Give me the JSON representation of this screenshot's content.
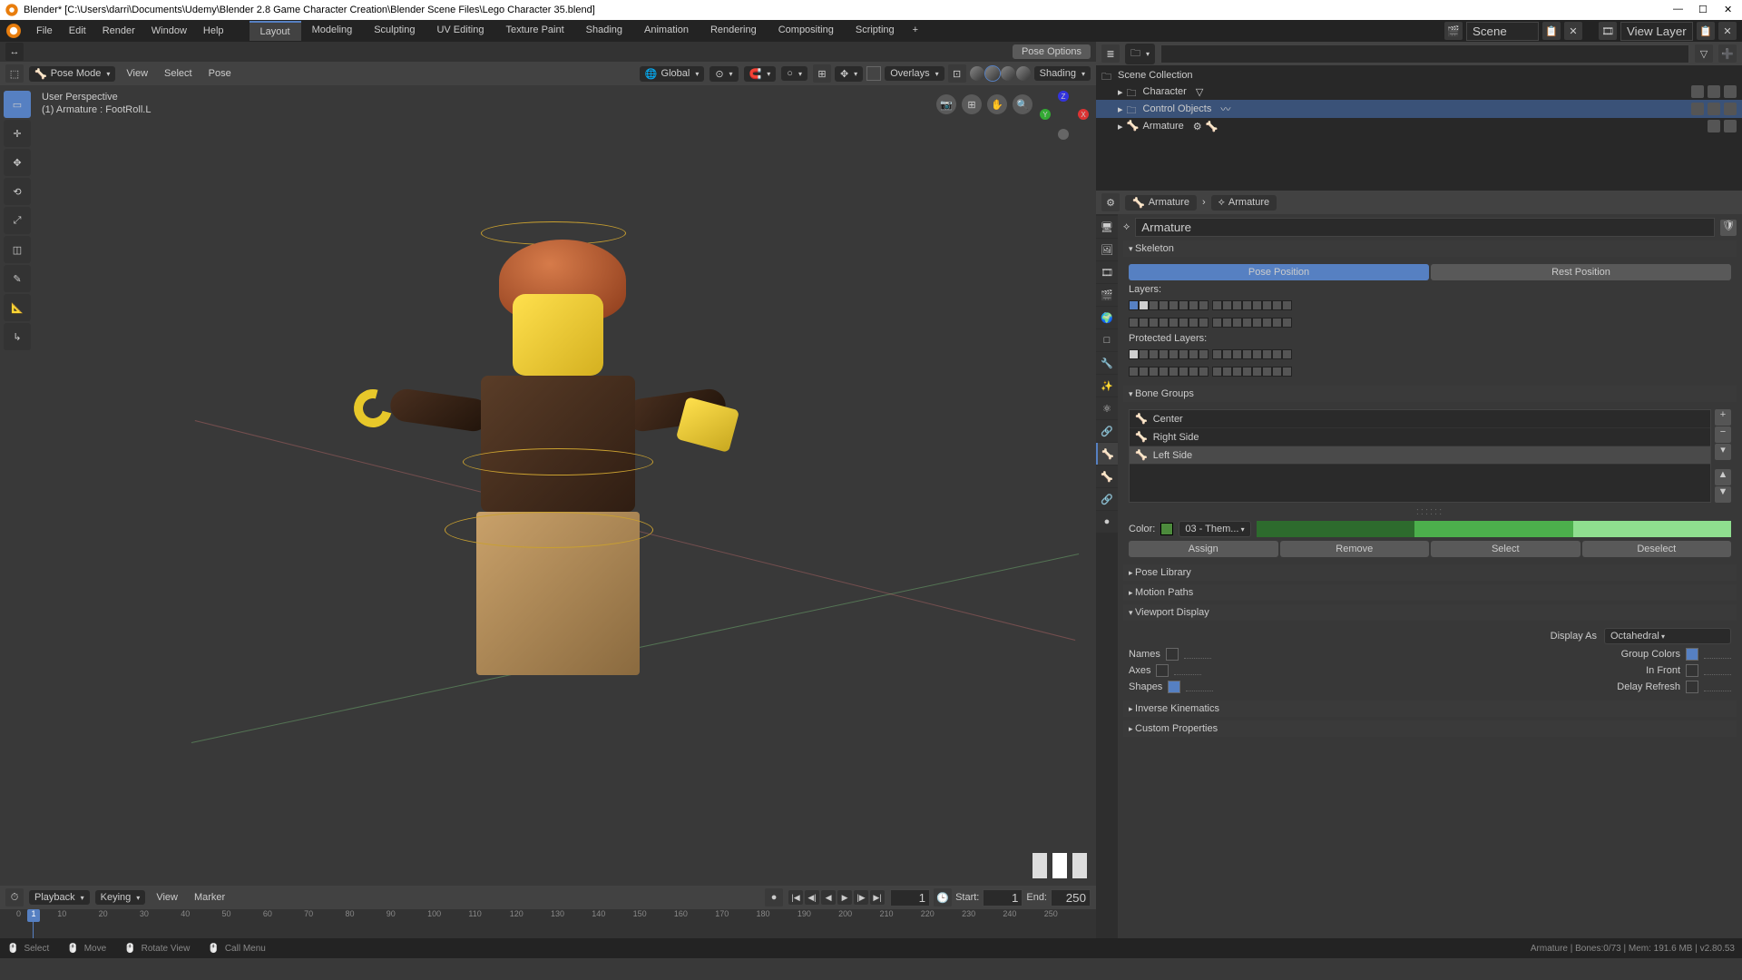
{
  "title": "Blender* [C:\\Users\\darri\\Documents\\Udemy\\Blender 2.8 Game Character Creation\\Blender Scene Files\\Lego Character 35.blend]",
  "topmenu": {
    "items": [
      "File",
      "Edit",
      "Render",
      "Window",
      "Help"
    ]
  },
  "workspaces": {
    "tabs": [
      "Layout",
      "Modeling",
      "Sculpting",
      "UV Editing",
      "Texture Paint",
      "Shading",
      "Animation",
      "Rendering",
      "Compositing",
      "Scripting"
    ],
    "active": 0
  },
  "scene": {
    "label": "Scene",
    "layer_label": "View Layer"
  },
  "viewport": {
    "mode": "Pose Mode",
    "menus": [
      "View",
      "Select",
      "Pose"
    ],
    "orientation": "Global",
    "overlays_label": "Overlays",
    "shading_label": "Shading",
    "pose_options": "Pose Options",
    "info_line1": "User Perspective",
    "info_line2": "(1) Armature : FootRoll.L"
  },
  "timeline": {
    "playback": "Playback",
    "keying": "Keying",
    "menus": [
      "View",
      "Marker"
    ],
    "current": 1,
    "start_label": "Start:",
    "start": 1,
    "end_label": "End:",
    "end": 250,
    "ticks": [
      0,
      10,
      20,
      30,
      40,
      50,
      60,
      70,
      80,
      90,
      100,
      110,
      120,
      130,
      140,
      150,
      160,
      170,
      180,
      190,
      200,
      210,
      220,
      230,
      240,
      250
    ]
  },
  "statusbar": {
    "items": [
      {
        "icon": "mouse-left-icon",
        "label": "Select"
      },
      {
        "icon": "mouse-middle-icon",
        "label": "Move"
      },
      {
        "icon": "mouse-middle-icon",
        "label": "Rotate View"
      },
      {
        "icon": "mouse-right-icon",
        "label": "Call Menu"
      }
    ],
    "right": "Armature | Bones:0/73 | Mem: 191.6 MB | v2.80.53"
  },
  "outliner": {
    "root": "Scene Collection",
    "items": [
      {
        "name": "Character",
        "indent": 1,
        "selected": false,
        "icon": "collection-icon"
      },
      {
        "name": "Control Objects",
        "indent": 1,
        "selected": true,
        "icon": "collection-icon"
      },
      {
        "name": "Armature",
        "indent": 1,
        "selected": false,
        "icon": "armature-icon"
      }
    ]
  },
  "properties": {
    "crumb1": "Armature",
    "crumb2": "Armature",
    "name_field": "Armature",
    "skeleton": {
      "title": "Skeleton",
      "pose_position": "Pose Position",
      "rest_position": "Rest Position",
      "layers_label": "Layers:",
      "protected_label": "Protected Layers:"
    },
    "bone_groups": {
      "title": "Bone Groups",
      "items": [
        "Center",
        "Right Side",
        "Left Side"
      ],
      "selected": 2,
      "color_label": "Color:",
      "color_set": "03 - Them...",
      "assign": "Assign",
      "remove": "Remove",
      "select": "Select",
      "deselect": "Deselect"
    },
    "panels_collapsed": [
      "Pose Library",
      "Motion Paths"
    ],
    "viewport_display": {
      "title": "Viewport Display",
      "display_as_label": "Display As",
      "display_as": "Octahedral",
      "names": "Names",
      "group_colors": "Group Colors",
      "axes": "Axes",
      "in_front": "In Front",
      "shapes": "Shapes",
      "delay_refresh": "Delay Refresh"
    },
    "panels_collapsed2": [
      "Inverse Kinematics",
      "Custom Properties"
    ]
  }
}
